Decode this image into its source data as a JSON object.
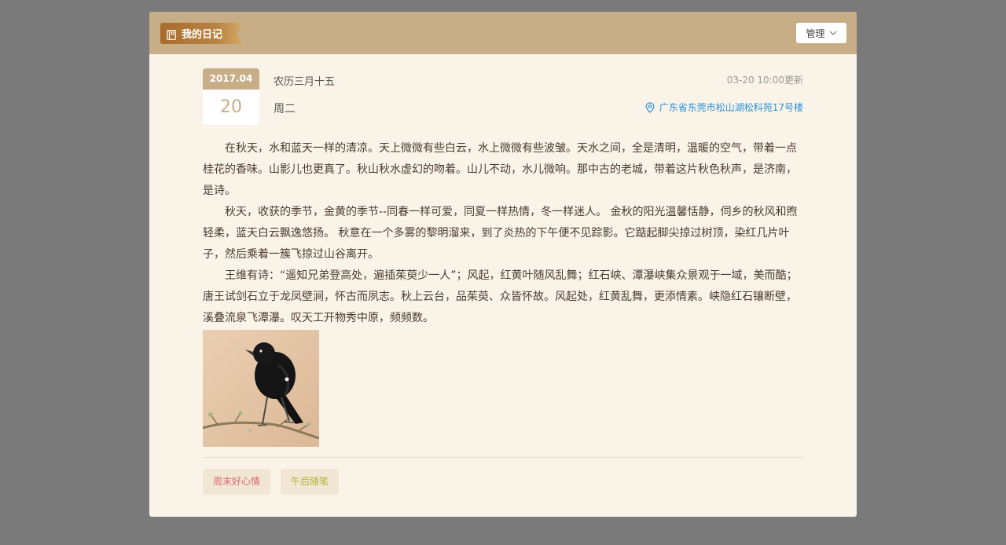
{
  "header": {
    "title": "我的日记",
    "manage_label": "管理"
  },
  "entry": {
    "year_month": "2017.04",
    "day": "20",
    "lunar": "农历三月十五",
    "weekday": "周二",
    "updated": "03-20 10:00更新",
    "location": "广东省东莞市松山湖松科苑17号楼",
    "paragraphs": [
      "在秋天，水和蓝天一样的清凉。天上微微有些白云，水上微微有些波皱。天水之间，全是清明，温暖的空气，带着一点桂花的香味。山影儿也更真了。秋山秋水虚幻的吻着。山儿不动，水儿微响。那中古的老城，带着这片秋色秋声，是济南，是诗。",
      "秋天，收获的季节，金黄的季节--同春一样可爱，同夏一样热情，冬一样迷人。 金秋的阳光温馨恬静，伺乡的秋风和煦轻柔，蓝天白云飘逸悠扬。 秋意在一个多雾的黎明溜来，到了炎热的下午便不见踪影。它踮起脚尖掠过树顶，染红几片叶子，然后乘着一簇飞掠过山谷离开。",
      "王维有诗：“遥知兄弟登高处，遍插茱萸少一人”；风起，红黄叶随风乱舞；红石峡、潭瀑峡集众景观于一域，美而酷；唐王试剑石立于龙凤壁涧，怀古而夙志。秋上云台，品茱萸、众皆怀故。风起处，红黄乱舞，更添情素。峡隐红石镶断壁，溪叠流泉飞潭瀑。叹天工开物秀中原，频频数。"
    ],
    "photo_icon": "black-bird-on-branch",
    "tags": [
      "周末好心情",
      "午后随笔"
    ]
  },
  "colors": {
    "header_bg": "#c8ae87",
    "panel_bg": "#faf4e8",
    "location_blue": "#2a8fd8",
    "tag1_text": "#d86a6a",
    "tag2_text": "#b4b33a"
  }
}
